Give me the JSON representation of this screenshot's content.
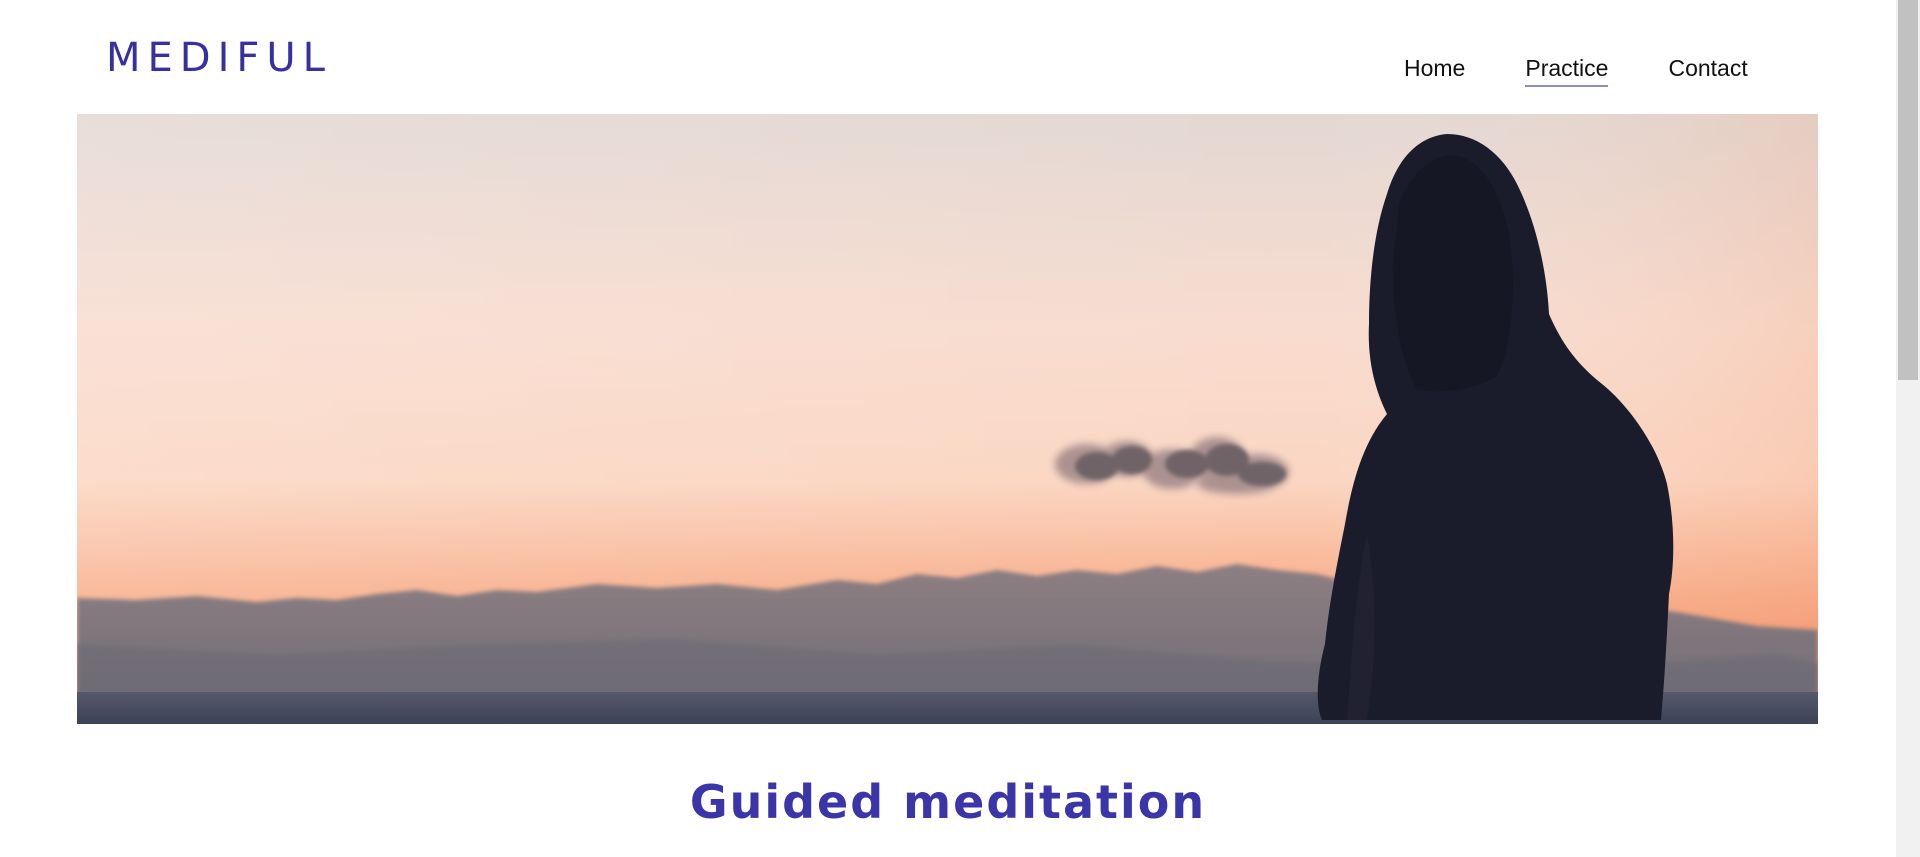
{
  "header": {
    "logo_text": "MEDIFUL",
    "nav": {
      "home": "Home",
      "practice": "Practice",
      "contact": "Contact"
    },
    "active_nav": "Practice"
  },
  "hero": {
    "image_subject": "hooded-person-silhouette-at-sunset"
  },
  "main": {
    "heading": "Guided meditation"
  },
  "colors": {
    "brand": "#3730a3",
    "heading": "#3a35a8",
    "nav_text": "#111111"
  }
}
